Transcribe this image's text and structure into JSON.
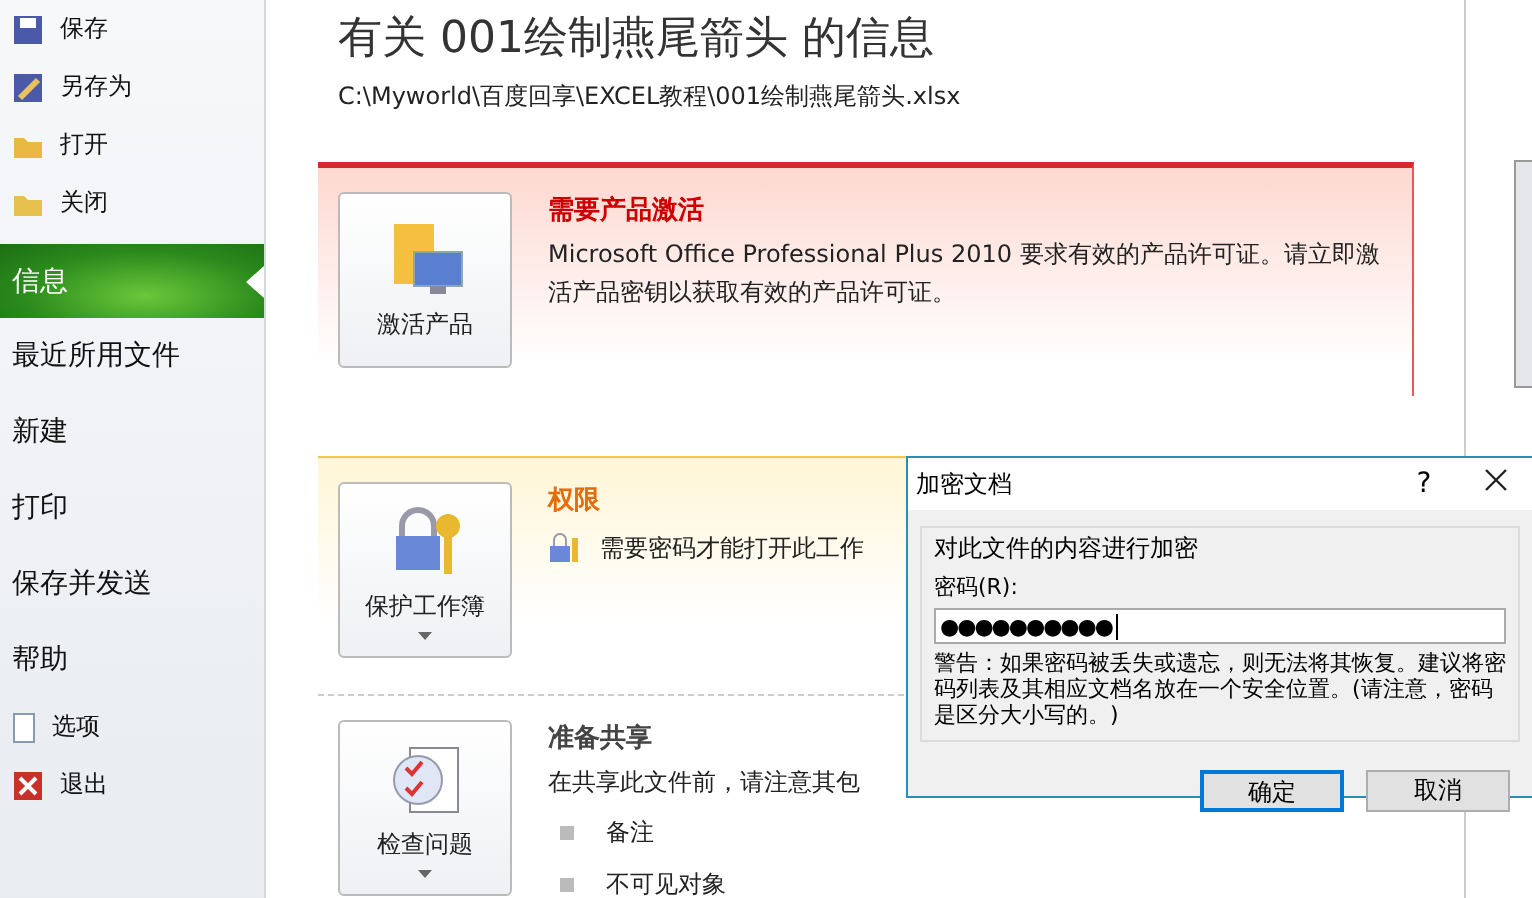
{
  "sidebar": {
    "items": [
      {
        "kind": "command",
        "label": "保存",
        "selected": false
      },
      {
        "kind": "command",
        "label": "另存为",
        "selected": false
      },
      {
        "kind": "command",
        "label": "打开",
        "selected": false
      },
      {
        "kind": "command",
        "label": "关闭",
        "selected": false
      },
      {
        "kind": "section",
        "label": "信息",
        "selected": true
      },
      {
        "kind": "section",
        "label": "最近所用文件",
        "selected": false
      },
      {
        "kind": "section",
        "label": "新建",
        "selected": false
      },
      {
        "kind": "section",
        "label": "打印",
        "selected": false
      },
      {
        "kind": "section",
        "label": "保存并发送",
        "selected": false
      },
      {
        "kind": "section",
        "label": "帮助",
        "selected": false
      },
      {
        "kind": "command",
        "label": "选项",
        "selected": false
      },
      {
        "kind": "command",
        "label": "退出",
        "selected": false
      }
    ]
  },
  "title": "有关 001绘制燕尾箭头 的信息",
  "path": "C:\\Myworld\\百度回享\\EXCEL教程\\001绘制燕尾箭头.xlsx",
  "cards": [
    {
      "kind": "alert",
      "button": "激活产品",
      "heading": "需要产品激活",
      "text": "Microsoft Office Professional Plus 2010 要求有效的产品许可证。请立即激活产品密钥以获取有效的产品许可证。"
    },
    {
      "kind": "warning",
      "button": "保护工作簿",
      "heading": "权限",
      "text": "需要密码才能打开此工作"
    },
    {
      "kind": "plain",
      "button": "检查问题",
      "heading": "准备共享",
      "text": "在共享此文件前，请注意其包",
      "bullets": [
        "备注",
        "不可见对象"
      ]
    }
  ],
  "dialog": {
    "title": "加密文档",
    "help": "?",
    "group": "对此文件的内容进行加密",
    "field_label": "密码(R):",
    "value": "●●●●●●●●●●",
    "warning": "警告：如果密码被丢失或遗忘，则无法将其恢复。建议将密码列表及其相应文档名放在一个安全位置。(请注意，密码是区分大小写的。)",
    "buttons": [
      {
        "label": "确定",
        "focused": true
      },
      {
        "label": "取消",
        "focused": false
      }
    ]
  }
}
